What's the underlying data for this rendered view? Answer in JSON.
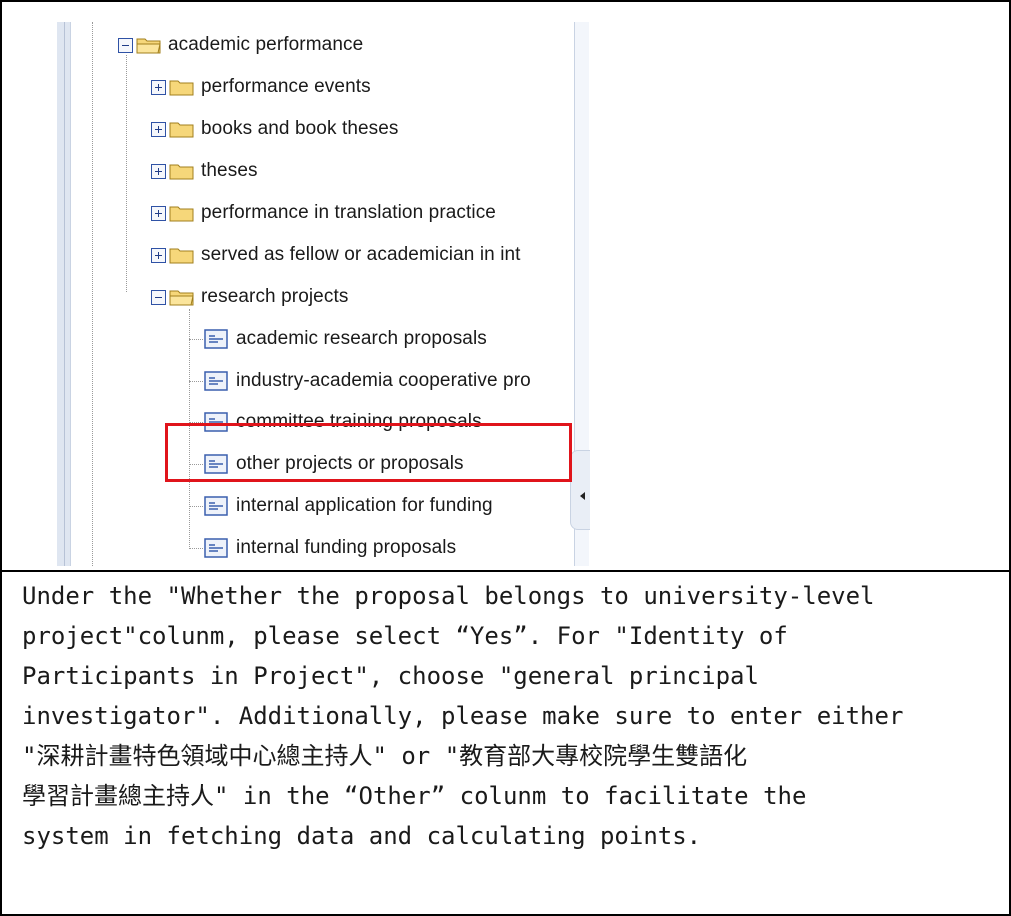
{
  "tree": {
    "root": {
      "label": "academic performance",
      "expanded": true,
      "icon": "folder-open-icon"
    },
    "children": [
      {
        "label": "performance events",
        "expanded": false,
        "icon": "folder-icon"
      },
      {
        "label": "books and book theses",
        "expanded": false,
        "icon": "folder-icon"
      },
      {
        "label": "theses",
        "expanded": false,
        "icon": "folder-icon"
      },
      {
        "label": "performance in translation practice",
        "expanded": false,
        "icon": "folder-icon"
      },
      {
        "label": "served as fellow or academician in int",
        "expanded": false,
        "icon": "folder-icon"
      },
      {
        "label": "research projects",
        "expanded": true,
        "icon": "folder-open-icon"
      }
    ],
    "research_projects_items": [
      {
        "label": "academic research proposals",
        "icon": "form-icon"
      },
      {
        "label": "industry-academia cooperative pro",
        "icon": "form-icon"
      },
      {
        "label": "committee training proposals",
        "icon": "form-icon"
      },
      {
        "label": "other projects or proposals",
        "icon": "form-icon",
        "highlighted": true
      },
      {
        "label": "internal application for funding",
        "icon": "form-icon"
      },
      {
        "label": "internal funding proposals",
        "icon": "form-icon"
      }
    ]
  },
  "instruction": {
    "lines": [
      "Under the \"Whether the proposal belongs to university-level",
      "project\"colunm, please select “Yes”. For \"Identity of",
      "Participants in Project\", choose \"general principal",
      "investigator\". Additionally, please make sure to enter either",
      "\"深耕計畫特色領域中心總主持人\" or \"教育部大專校院學生雙語化",
      "學習計畫總主持人\" in the “Other” colunm to facilitate the",
      "system in fetching data and calculating points."
    ]
  },
  "colors": {
    "highlight": "#e0141b",
    "border": "#000000",
    "toggle_border": "#2f52a5"
  }
}
